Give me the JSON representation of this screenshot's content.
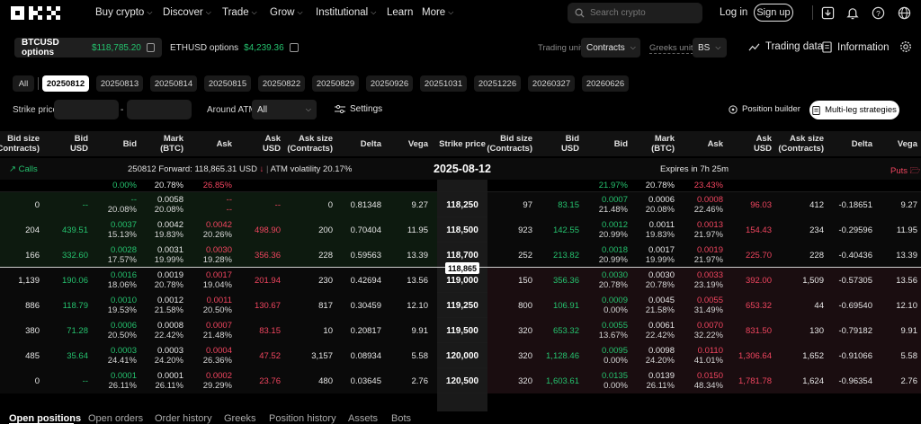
{
  "nav": {
    "items": [
      "Buy crypto",
      "Discover",
      "Trade",
      "Grow",
      "Institutional",
      "Learn",
      "More"
    ],
    "search_placeholder": "Search crypto",
    "login": "Log in",
    "signup": "Sign up"
  },
  "markets": [
    {
      "label": "BTCUSD options",
      "price": "$118,785.20"
    },
    {
      "label": "ETHUSD options",
      "price": "$4,239.36"
    }
  ],
  "toolbar": {
    "trading_unit_label": "Trading unit",
    "trading_unit_value": "Contracts",
    "greeks_unit_label": "Greeks unit",
    "greeks_unit_value": "BS",
    "trading_data": "Trading data",
    "information": "Information"
  },
  "dates": [
    "All",
    "20250812",
    "20250813",
    "20250814",
    "20250815",
    "20250822",
    "20250829",
    "20250926",
    "20251031",
    "20251226",
    "20260327",
    "20260626"
  ],
  "filters": {
    "strike_price": "Strike price",
    "dash": "-",
    "around_atm": "Around ATM",
    "atm_value": "All",
    "settings": "Settings",
    "position_builder": "Position builder",
    "multi_leg": "Multi-leg strategies"
  },
  "headers": {
    "calls": [
      "Bid size\n(Contracts)",
      "Bid\nUSD",
      "Bid",
      "Mark\n(BTC)",
      "Ask",
      "Ask\nUSD",
      "Ask size\n(Contracts)",
      "Delta",
      "Vega"
    ],
    "strike": "Strike price",
    "puts": [
      "Bid size\n(Contracts)",
      "Bid\nUSD",
      "Bid",
      "Mark\n(BTC)",
      "Ask",
      "Ask\nUSD",
      "Ask size\n(Contracts)",
      "Delta",
      "Vega"
    ]
  },
  "info": {
    "calls": "Calls",
    "puts": "Puts",
    "forward": "250812 Forward: 118,865.31 USD",
    "atm_vol": "ATM volatility 20.17%",
    "date": "2025-08-12",
    "expires": "Expires in 7h 25m"
  },
  "current_price": "118,865",
  "partial_top": {
    "c_mark": "0.00%",
    "c_mark2": "20.78%",
    "c_ask": "26.85%",
    "p_bid": "21.97%",
    "p_mark": "20.78%",
    "p_ask": "23.43%"
  },
  "rows": [
    {
      "strike": "118,250",
      "c": [
        "0",
        "--",
        "--|20.08%",
        "0.0058|20.08%",
        "--|--",
        "--",
        "0",
        "0.81348",
        "9.27"
      ],
      "p": [
        "97",
        "83.15",
        "0.0007|21.48%",
        "0.0006|20.08%",
        "0.0008|22.46%",
        "96.03",
        "412",
        "-0.18651",
        "9.27"
      ]
    },
    {
      "strike": "118,500",
      "c": [
        "204",
        "439.51",
        "0.0037|15.13%",
        "0.0042|19.83%",
        "0.0042|20.26%",
        "498.90",
        "200",
        "0.70404",
        "11.95"
      ],
      "p": [
        "923",
        "142.55",
        "0.0012|20.99%",
        "0.0011|19.83%",
        "0.0013|21.97%",
        "154.43",
        "234",
        "-0.29596",
        "11.95"
      ]
    },
    {
      "strike": "118,700",
      "c": [
        "166",
        "332.60",
        "0.0028|17.57%",
        "0.0031|19.99%",
        "0.0030|19.28%",
        "356.36",
        "228",
        "0.59563",
        "13.39"
      ],
      "p": [
        "252",
        "213.82",
        "0.0018|20.99%",
        "0.0017|19.99%",
        "0.0019|21.97%",
        "225.70",
        "228",
        "-0.40436",
        "13.39"
      ]
    },
    {
      "strike": "119,000",
      "c": [
        "1,139",
        "190.06",
        "0.0016|18.06%",
        "0.0019|20.78%",
        "0.0017|19.04%",
        "201.94",
        "230",
        "0.42694",
        "13.56"
      ],
      "p": [
        "150",
        "356.36",
        "0.0030|20.78%",
        "0.0030|20.78%",
        "0.0033|23.19%",
        "392.00",
        "1,509",
        "-0.57305",
        "13.56"
      ]
    },
    {
      "strike": "119,250",
      "c": [
        "886",
        "118.79",
        "0.0010|19.53%",
        "0.0012|21.58%",
        "0.0011|20.50%",
        "130.67",
        "817",
        "0.30459",
        "12.10"
      ],
      "p": [
        "800",
        "106.91",
        "0.0009|0.00%",
        "0.0045|21.58%",
        "0.0055|31.49%",
        "653.32",
        "44",
        "-0.69540",
        "12.10"
      ]
    },
    {
      "strike": "119,500",
      "c": [
        "380",
        "71.28",
        "0.0006|20.50%",
        "0.0008|22.42%",
        "0.0007|21.48%",
        "83.15",
        "10",
        "0.20817",
        "9.91"
      ],
      "p": [
        "320",
        "653.32",
        "0.0055|13.67%",
        "0.0061|22.42%",
        "0.0070|32.22%",
        "831.50",
        "130",
        "-0.79182",
        "9.91"
      ]
    },
    {
      "strike": "120,000",
      "c": [
        "485",
        "35.64",
        "0.0003|24.41%",
        "0.0003|24.20%",
        "0.0004|26.36%",
        "47.52",
        "3,157",
        "0.08934",
        "5.58"
      ],
      "p": [
        "320",
        "1,128.46",
        "0.0095|0.00%",
        "0.0098|24.20%",
        "0.0110|41.01%",
        "1,306.64",
        "1,652",
        "-0.91066",
        "5.58"
      ]
    },
    {
      "strike": "120,500",
      "c": [
        "0",
        "--",
        "0.0001|26.11%",
        "0.0001|26.11%",
        "0.0002|29.29%",
        "23.76",
        "480",
        "0.03645",
        "2.76"
      ],
      "p": [
        "320",
        "1,603.61",
        "0.0135|0.00%",
        "0.0139|26.11%",
        "0.0150|48.34%",
        "1,781.78",
        "1,624",
        "-0.96354",
        "2.76"
      ]
    }
  ],
  "tabs": [
    "Open positions",
    "Open orders",
    "Order history",
    "Greeks",
    "Position history",
    "Assets",
    "Bots"
  ]
}
